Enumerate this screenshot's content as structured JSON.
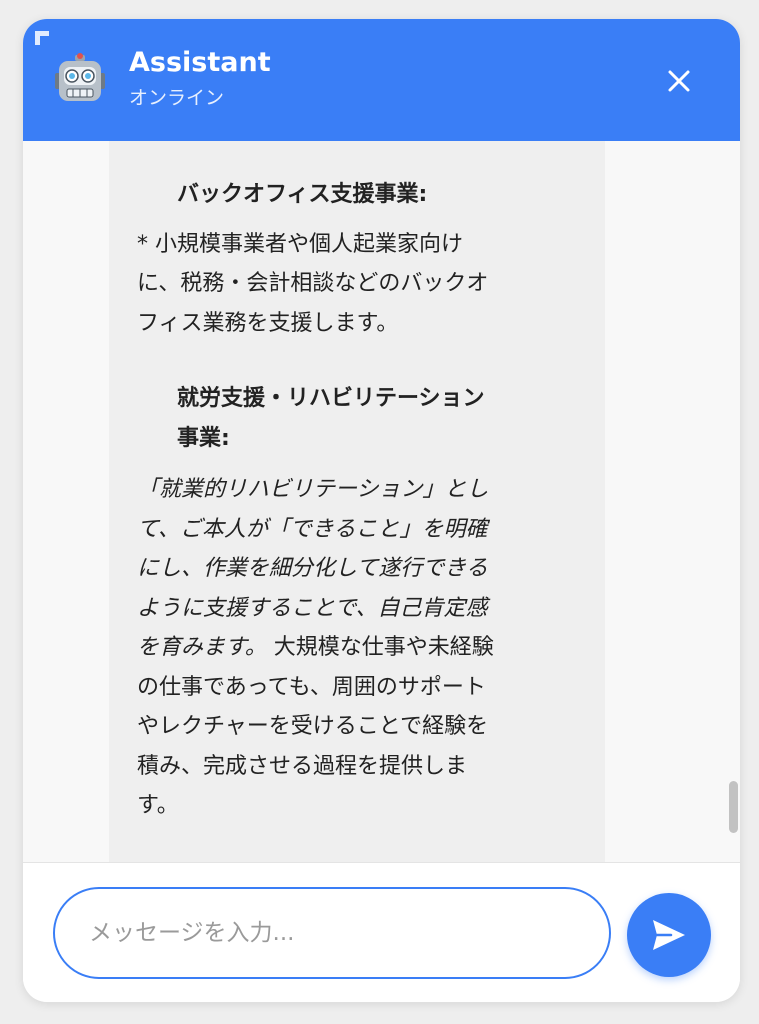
{
  "header": {
    "title": "Assistant",
    "status": "オンライン",
    "avatar_icon": "robot-face-icon",
    "close_icon": "close-icon",
    "accent_color": "#3a7ef6"
  },
  "message": {
    "sections": [
      {
        "heading": "バックオフィス支援事業:",
        "lines": [
          "* 小規模事業者や個人起業家向け",
          "に、税務・会計相談などのバックオ",
          "フィス業務を支援します。"
        ]
      },
      {
        "heading_lines": [
          "就労支援・リハビリテーション",
          "事業:"
        ],
        "lines": [
          {
            "text": "「就業的リハビリテーション」とし",
            "italic": true
          },
          {
            "text": "て、ご本人が「できること」を明確",
            "italic": true
          },
          {
            "text": "にし、作業を細分化して遂行できる",
            "italic": true
          },
          {
            "text": "ように支援することで、自己肯定感",
            "italic": true
          },
          {
            "text": "を育みます。",
            "italic": true,
            "rest": " 大規模な仕事や未経験"
          },
          {
            "text": "の仕事であっても、周囲のサポート",
            "italic": false
          },
          {
            "text": "やレクチャーを受けることで経験を",
            "italic": false
          },
          {
            "text": "積み、完成させる過程を提供しま",
            "italic": false
          },
          {
            "text": "す。",
            "italic": false
          }
        ]
      }
    ]
  },
  "composer": {
    "placeholder": "メッセージを入力...",
    "value": "",
    "send_icon": "send-icon"
  }
}
